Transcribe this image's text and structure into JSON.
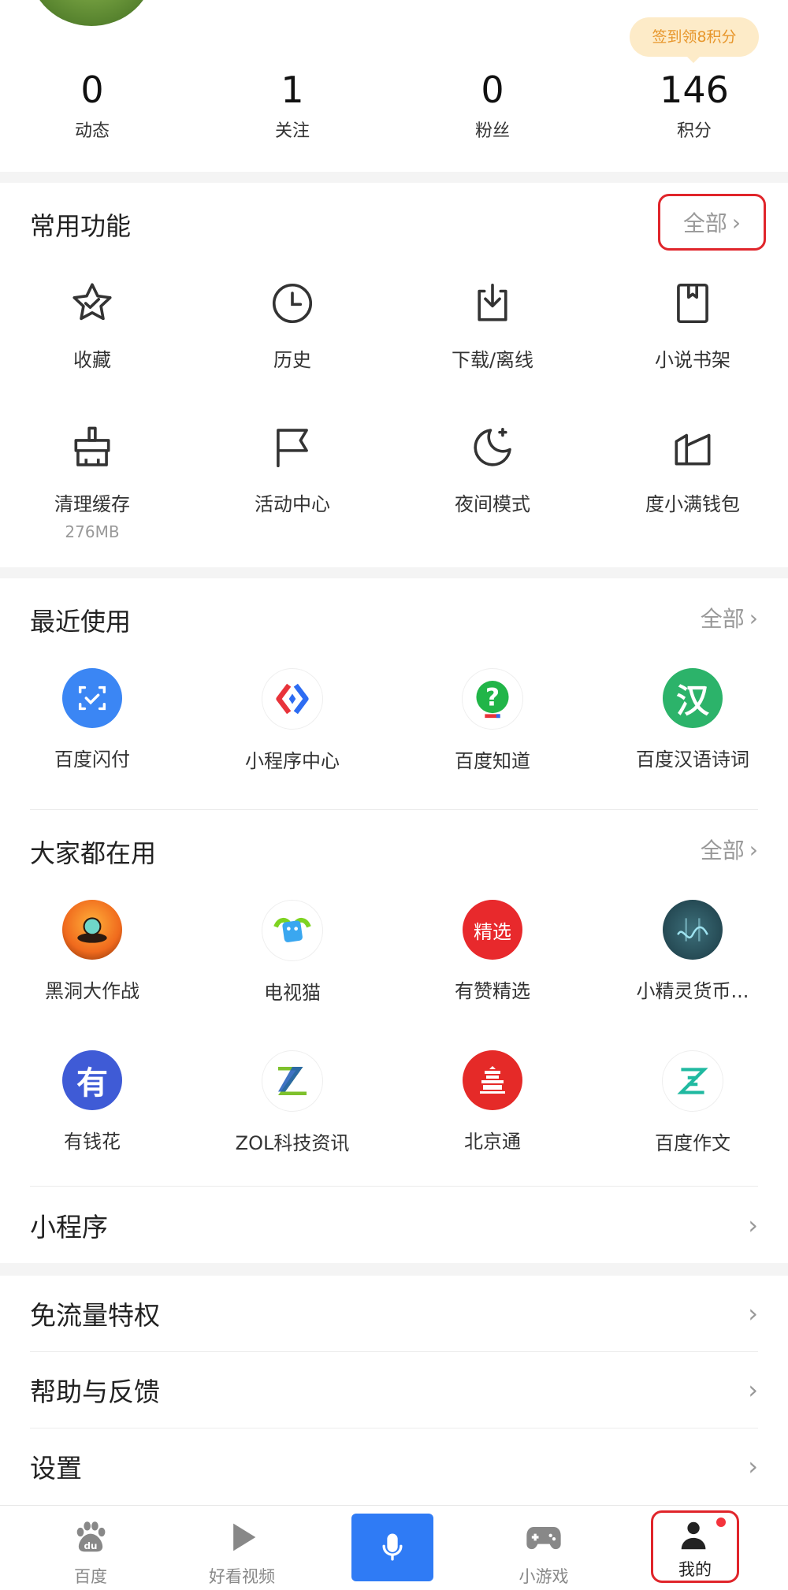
{
  "profile": {
    "checkin_label": "签到领8积分",
    "stats": [
      {
        "value": "0",
        "label": "动态"
      },
      {
        "value": "1",
        "label": "关注"
      },
      {
        "value": "0",
        "label": "粉丝"
      },
      {
        "value": "146",
        "label": "积分"
      }
    ]
  },
  "common": {
    "title": "常用功能",
    "more": "全部",
    "items": [
      {
        "label": "收藏",
        "icon": "star-icon"
      },
      {
        "label": "历史",
        "icon": "clock-icon"
      },
      {
        "label": "下载/离线",
        "icon": "download-icon"
      },
      {
        "label": "小说书架",
        "icon": "bookmark-icon"
      },
      {
        "label": "清理缓存",
        "icon": "broom-icon",
        "sub": "276MB"
      },
      {
        "label": "活动中心",
        "icon": "flag-icon"
      },
      {
        "label": "夜间模式",
        "icon": "moon-icon"
      },
      {
        "label": "度小满钱包",
        "icon": "wallet-icon"
      }
    ]
  },
  "recent": {
    "title": "最近使用",
    "more": "全部",
    "items": [
      {
        "label": "百度闪付"
      },
      {
        "label": "小程序中心"
      },
      {
        "label": "百度知道"
      },
      {
        "label": "百度汉语诗词",
        "glyph": "汉"
      }
    ]
  },
  "popular": {
    "title": "大家都在用",
    "more": "全部",
    "items": [
      {
        "label": "黑洞大作战"
      },
      {
        "label": "电视猫"
      },
      {
        "label": "有赞精选",
        "glyph": "精选"
      },
      {
        "label": "小精灵货币..."
      },
      {
        "label": "有钱花",
        "glyph": "有"
      },
      {
        "label": "ZOL科技资讯",
        "glyph": "Z"
      },
      {
        "label": "北京通"
      },
      {
        "label": "百度作文"
      }
    ]
  },
  "rows": [
    {
      "label": "小程序"
    },
    {
      "label": "免流量特权"
    },
    {
      "label": "帮助与反馈"
    },
    {
      "label": "设置"
    }
  ],
  "tabbar": [
    {
      "label": "百度"
    },
    {
      "label": "好看视频"
    },
    {
      "label": "小游戏"
    },
    {
      "label": "我的"
    }
  ],
  "colors": {
    "accent": "#2f7bf5",
    "highlight": "#e0252b",
    "checkin_bg": "#fdebc8",
    "checkin_text": "#e7962b"
  }
}
